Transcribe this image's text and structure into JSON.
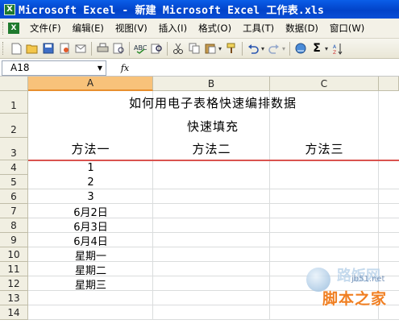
{
  "window": {
    "app_icon": "excel-icon",
    "title": "Microsoft Excel - 新建 Microsoft Excel 工作表.xls"
  },
  "menubar": {
    "items": [
      "文件(F)",
      "编辑(E)",
      "视图(V)",
      "插入(I)",
      "格式(O)",
      "工具(T)",
      "数据(D)",
      "窗口(W)"
    ]
  },
  "toolbar": {
    "icons": [
      "new-icon",
      "open-icon",
      "save-icon",
      "permission-icon",
      "email-icon",
      "print-icon",
      "print-preview-icon",
      "spelling-icon",
      "research-icon",
      "cut-icon",
      "copy-icon",
      "paste-icon",
      "format-painter-icon",
      "undo-icon",
      "redo-icon",
      "hyperlink-icon",
      "autosum-icon",
      "sort-icon"
    ],
    "sum_symbol": "Σ"
  },
  "formula_bar": {
    "name_box": "A18",
    "fx_label": "fx",
    "formula": ""
  },
  "sheet": {
    "selected_cell": "A18",
    "columns": [
      "A",
      "B",
      "C"
    ],
    "rows": [
      "1",
      "2",
      "3",
      "4",
      "5",
      "6",
      "7",
      "8",
      "9",
      "10",
      "11",
      "12",
      "13",
      "14"
    ],
    "row1_title": "如何用电子表格快速编排数据",
    "row2_subtitle": "快速填充",
    "row3_headers": [
      "方法一",
      "方法二",
      "方法三"
    ],
    "col_a_values": [
      "1",
      "2",
      "3",
      "6月2日",
      "6月3日",
      "6月4日",
      "星期一",
      "星期二",
      "星期三"
    ]
  },
  "watermark": {
    "brand": "路饭网",
    "site": "jb51.net",
    "name": "脚本之家"
  }
}
